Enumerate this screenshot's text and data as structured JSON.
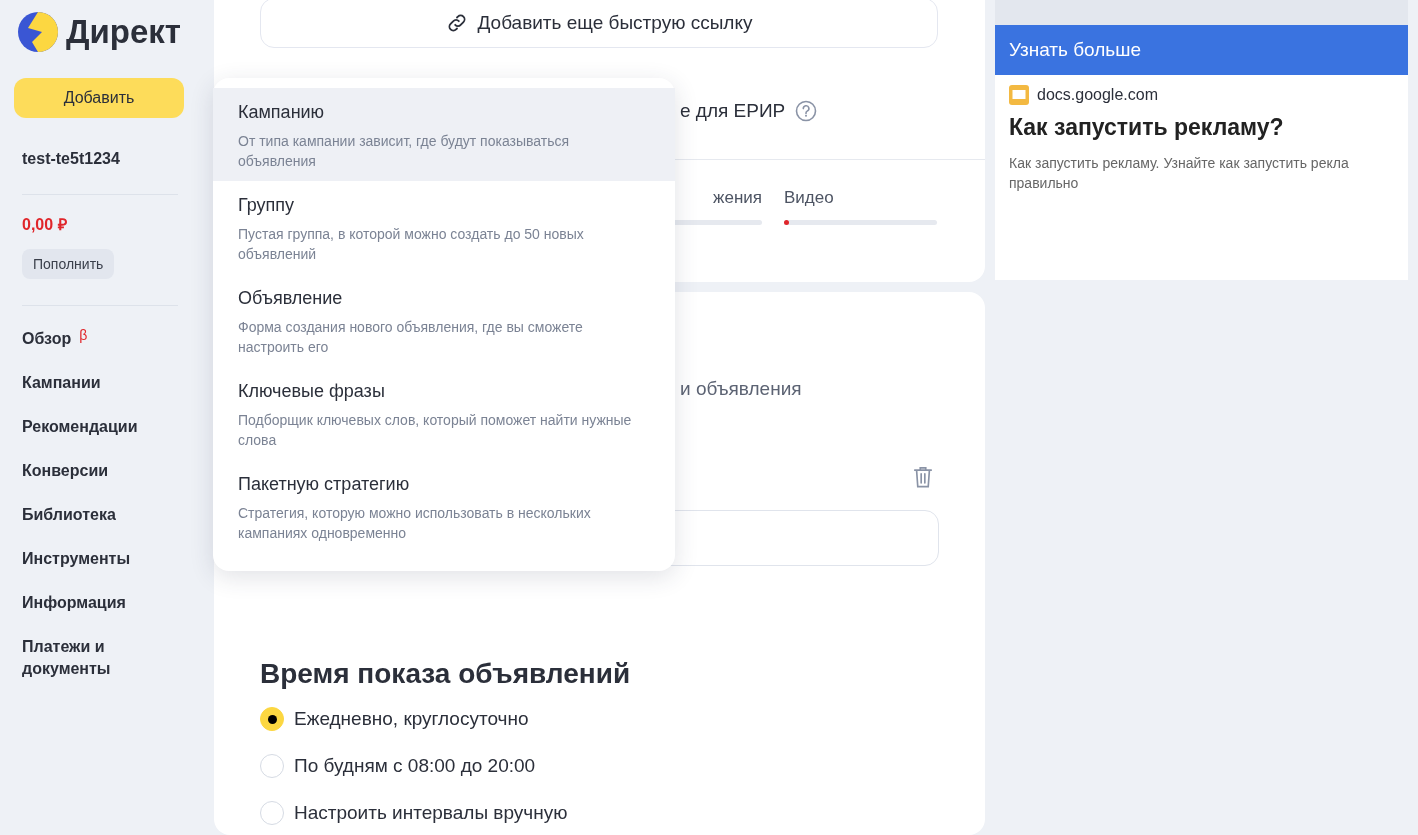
{
  "sidebar": {
    "logo": "Директ",
    "add_button": "Добавить",
    "account": "test-te5t1234",
    "balance": "0,00 ₽",
    "topup_button": "Пополнить",
    "nav": [
      {
        "label": "Обзор",
        "badge": "β"
      },
      {
        "label": "Кампании"
      },
      {
        "label": "Рекомендации"
      },
      {
        "label": "Конверсии"
      },
      {
        "label": "Библиотека"
      },
      {
        "label": "Инструменты"
      },
      {
        "label": "Информация"
      },
      {
        "label": "Платежи и документы"
      }
    ]
  },
  "main": {
    "quick_link_button": "Добавить еще быструю ссылку",
    "erir_text": "е для ЕРИР",
    "tabs": [
      {
        "label": "жения"
      },
      {
        "label": "Видео",
        "level": 0.02
      }
    ],
    "ads_text": "и объявления",
    "schedule": {
      "title": "Время показа объявлений",
      "options": [
        {
          "label": "Ежедневно, круглосуточно",
          "selected": true
        },
        {
          "label": "По будням с 08:00 до 20:00",
          "selected": false
        },
        {
          "label": "Настроить интервалы вручную",
          "selected": false
        }
      ]
    }
  },
  "add_menu": {
    "items": [
      {
        "title": "Кампанию",
        "description": "От типа кампании зависит, где будут показываться объявления",
        "selected": true
      },
      {
        "title": "Группу",
        "description": "Пустая группа, в которой можно создать до 50 новых объявлений",
        "selected": false
      },
      {
        "title": "Объявление",
        "description": "Форма создания нового объявления, где вы сможете настроить его",
        "selected": false
      },
      {
        "title": "Ключевые фразы",
        "description": "Подборщик ключевых слов, который поможет найти нужные слова",
        "selected": false
      },
      {
        "title": "Пакетную стратегию",
        "description": "Стратегия, которую можно использовать в нескольких кампаниях одновременно",
        "selected": false
      }
    ]
  },
  "preview": {
    "header": "Узнать больше",
    "domain": "docs.google.com",
    "title": "Как запустить рекламу?",
    "text": "Как запустить рекламу. Узнайте как запустить рекла правильно"
  }
}
